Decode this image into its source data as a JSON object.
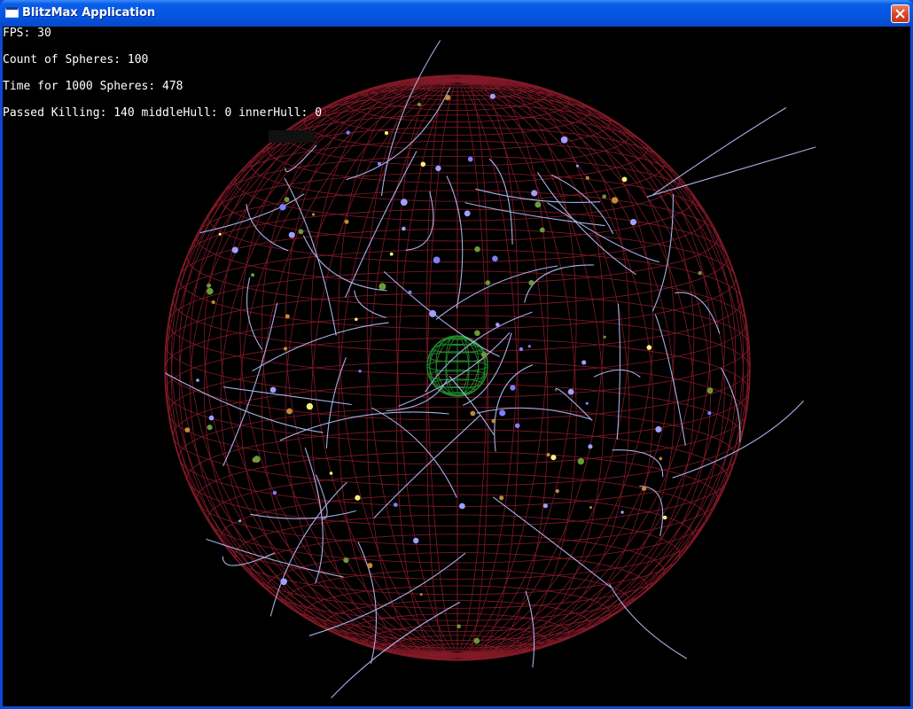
{
  "window": {
    "title": "BlitzMax Application",
    "icon": "app-window-icon",
    "close_icon": "close-icon",
    "accent_color": "#0554e3"
  },
  "hud": {
    "fps_line": "FPS: 30",
    "count_line": "Count of Spheres: 100",
    "time_line": "Time for 1000 Spheres: 478",
    "killing_line": "Passed Killing: 140 middleHull: 0 innerHull: 0"
  },
  "scene": {
    "outer_hull_color": "#8a1c2a",
    "inner_hull_color": "#1f8a2e",
    "trail_color": "#b8c4ff",
    "sphere_colors": [
      "#7b80ff",
      "#f2f07a",
      "#c08a3a",
      "#9ea0ff",
      "#6a9a3a"
    ]
  }
}
